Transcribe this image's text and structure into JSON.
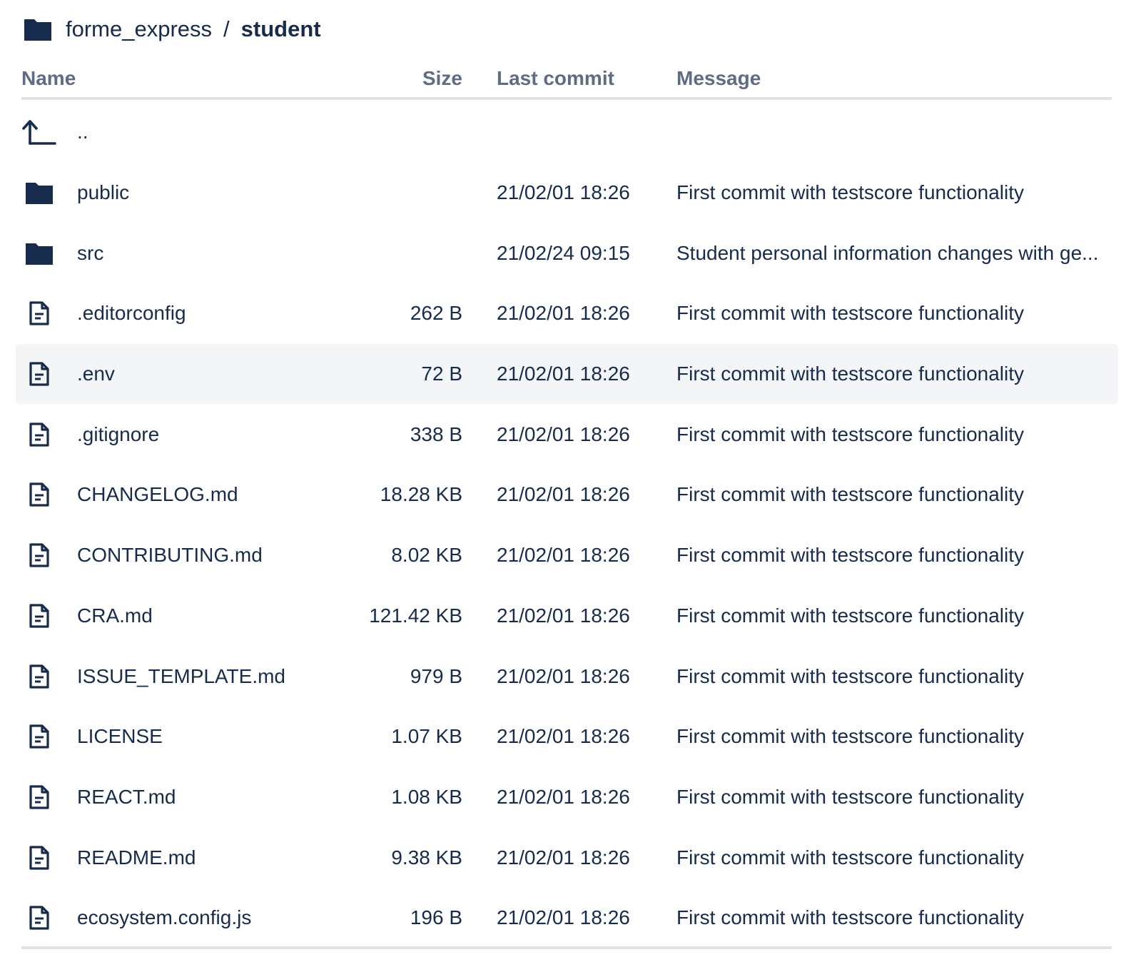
{
  "breadcrumb": {
    "parent": "forme_express",
    "separator": "/",
    "current": "student",
    "icon": "folder-icon"
  },
  "columns": {
    "name": "Name",
    "size": "Size",
    "last_commit": "Last commit",
    "message": "Message"
  },
  "rows": [
    {
      "type": "up",
      "icon": "parent-directory-icon",
      "name": "..",
      "size": "",
      "last_commit": "",
      "message": ""
    },
    {
      "type": "folder",
      "icon": "folder-icon",
      "name": "public",
      "size": "",
      "last_commit": "21/02/01 18:26",
      "message": "First commit with testscore functionality"
    },
    {
      "type": "folder",
      "icon": "folder-icon",
      "name": "src",
      "size": "",
      "last_commit": "21/02/24 09:15",
      "message": "Student personal information changes with ge..."
    },
    {
      "type": "file",
      "icon": "file-icon",
      "name": ".editorconfig",
      "size": "262 B",
      "last_commit": "21/02/01 18:26",
      "message": "First commit with testscore functionality"
    },
    {
      "type": "file",
      "icon": "file-icon",
      "name": ".env",
      "size": "72 B",
      "last_commit": "21/02/01 18:26",
      "message": "First commit with testscore functionality",
      "hover": true
    },
    {
      "type": "file",
      "icon": "file-icon",
      "name": ".gitignore",
      "size": "338 B",
      "last_commit": "21/02/01 18:26",
      "message": "First commit with testscore functionality"
    },
    {
      "type": "file",
      "icon": "file-icon",
      "name": "CHANGELOG.md",
      "size": "18.28 KB",
      "last_commit": "21/02/01 18:26",
      "message": "First commit with testscore functionality"
    },
    {
      "type": "file",
      "icon": "file-icon",
      "name": "CONTRIBUTING.md",
      "size": "8.02 KB",
      "last_commit": "21/02/01 18:26",
      "message": "First commit with testscore functionality"
    },
    {
      "type": "file",
      "icon": "file-icon",
      "name": "CRA.md",
      "size": "121.42 KB",
      "last_commit": "21/02/01 18:26",
      "message": "First commit with testscore functionality"
    },
    {
      "type": "file",
      "icon": "file-icon",
      "name": "ISSUE_TEMPLATE.md",
      "size": "979 B",
      "last_commit": "21/02/01 18:26",
      "message": "First commit with testscore functionality"
    },
    {
      "type": "file",
      "icon": "file-icon",
      "name": "LICENSE",
      "size": "1.07 KB",
      "last_commit": "21/02/01 18:26",
      "message": "First commit with testscore functionality"
    },
    {
      "type": "file",
      "icon": "file-icon",
      "name": "REACT.md",
      "size": "1.08 KB",
      "last_commit": "21/02/01 18:26",
      "message": "First commit with testscore functionality"
    },
    {
      "type": "file",
      "icon": "file-icon",
      "name": "README.md",
      "size": "9.38 KB",
      "last_commit": "21/02/01 18:26",
      "message": "First commit with testscore functionality"
    },
    {
      "type": "file",
      "icon": "file-icon",
      "name": "ecosystem.config.js",
      "size": "196 B",
      "last_commit": "21/02/01 18:26",
      "message": "First commit with testscore functionality"
    }
  ],
  "colors": {
    "text": "#172b4d",
    "header_text": "#5e6c84",
    "divider": "#dfe1e6",
    "hover_row": "#f4f5f7",
    "icon": "#172b4d"
  }
}
